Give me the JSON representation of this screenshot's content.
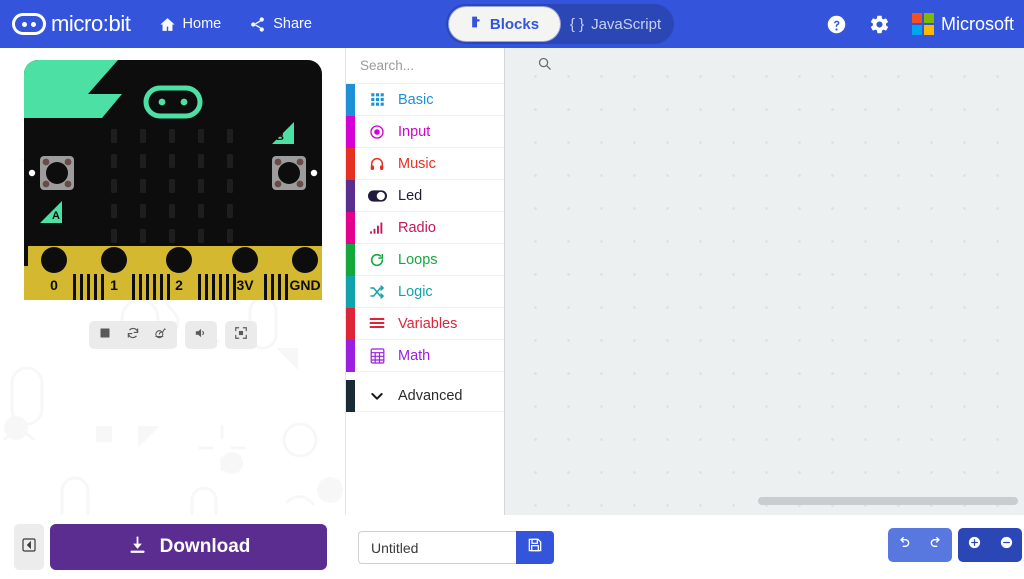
{
  "header": {
    "brand": "micro:bit",
    "brand_logo_icon": "microbit-logo-icon",
    "nav": [
      {
        "label": "Home",
        "icon": "home-icon"
      },
      {
        "label": "Share",
        "icon": "share-icon"
      }
    ],
    "toggle": {
      "blocks_label": "Blocks",
      "javascript_label": "JavaScript",
      "active": "Blocks"
    },
    "help_icon": "help-circle-icon",
    "settings_icon": "gear-icon",
    "microsoft_label": "Microsoft",
    "background_color": "#3455db",
    "ms_colors": [
      "#f25022",
      "#7fba00",
      "#00a4ef",
      "#ffb900"
    ]
  },
  "simulator": {
    "board": {
      "accent_color": "#4ce0a4",
      "body_color": "#0d0d0d",
      "button_a_label": "A",
      "button_b_label": "B",
      "pins": [
        "0",
        "1",
        "2",
        "3V",
        "GND"
      ],
      "pin_color": "#d4b830",
      "led_rows": 5,
      "led_cols": 5
    },
    "controls": [
      {
        "name": "stop-button",
        "icon": "stop-icon"
      },
      {
        "name": "restart-button",
        "icon": "refresh-icon"
      },
      {
        "name": "slow-motion-button",
        "icon": "snail-icon"
      },
      {
        "name": "mute-button",
        "icon": "speaker-icon"
      },
      {
        "name": "fullscreen-button",
        "icon": "expand-icon"
      }
    ]
  },
  "toolbox": {
    "search_placeholder": "Search...",
    "search_value": "",
    "search_icon": "search-icon",
    "categories": [
      {
        "label": "Basic",
        "color": "#1e90d6",
        "icon": "grid-dots-icon"
      },
      {
        "label": "Input",
        "color": "#d400d4",
        "icon": "target-icon"
      },
      {
        "label": "Music",
        "color": "#e63022",
        "icon": "headphones-icon"
      },
      {
        "label": "Led",
        "color": "#5b2d8e",
        "icon": "toggle-icon"
      },
      {
        "label": "Radio",
        "color": "#e3008c",
        "icon": "signal-bars-icon"
      },
      {
        "label": "Loops",
        "color": "#14a83c",
        "icon": "loop-arrow-icon"
      },
      {
        "label": "Logic",
        "color": "#11a3ab",
        "icon": "shuffle-icon"
      },
      {
        "label": "Variables",
        "color": "#e02438",
        "icon": "lines-icon"
      },
      {
        "label": "Math",
        "color": "#9b1fe0",
        "icon": "calculator-icon"
      }
    ],
    "advanced": {
      "label": "Advanced",
      "color": "#1a2b38",
      "icon": "chevron-down-icon"
    }
  },
  "workspace": {
    "background_color": "#ecf0f1",
    "grid": true,
    "scrollbar_horizontal": true
  },
  "footer": {
    "collapse_icon": "collapse-left-icon",
    "download_label": "Download",
    "download_icon": "download-icon",
    "download_color": "#5c2d91",
    "project_name_value": "Untitled",
    "project_name_placeholder": "Untitled",
    "save_icon": "save-disk-icon",
    "undo_icon": "undo-icon",
    "redo_icon": "redo-icon",
    "zoom_in_icon": "zoom-in-icon",
    "zoom_out_icon": "zoom-out-icon"
  }
}
